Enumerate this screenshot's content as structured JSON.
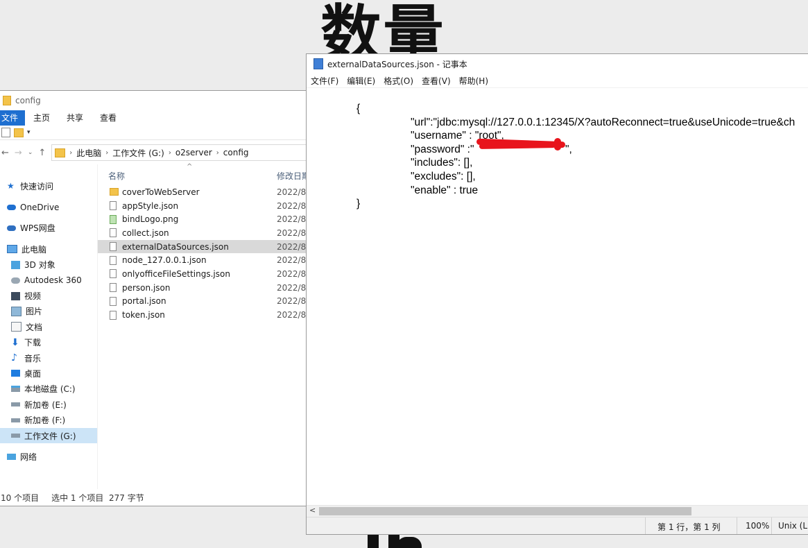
{
  "background": {
    "top_text": "数量"
  },
  "explorer": {
    "title": "config",
    "ribbon_tabs": [
      "文件",
      "主页",
      "共享",
      "查看"
    ],
    "address": [
      "此电脑",
      "工作文件 (G:)",
      "o2server",
      "config"
    ],
    "columns": {
      "name": "名称",
      "date": "修改日期"
    },
    "nav": [
      {
        "label": "快速访问",
        "icon": "star-icon"
      },
      {
        "label": "OneDrive",
        "icon": "cloud-icon"
      },
      {
        "label": "WPS网盘",
        "icon": "wps-cloud-icon"
      },
      {
        "label": "此电脑",
        "icon": "computer-icon"
      },
      {
        "label": "3D 对象",
        "icon": "cube-icon"
      },
      {
        "label": "Autodesk 360",
        "icon": "autodesk-icon"
      },
      {
        "label": "视频",
        "icon": "video-icon"
      },
      {
        "label": "图片",
        "icon": "pictures-icon"
      },
      {
        "label": "文档",
        "icon": "documents-icon"
      },
      {
        "label": "下载",
        "icon": "download-icon"
      },
      {
        "label": "音乐",
        "icon": "music-icon"
      },
      {
        "label": "桌面",
        "icon": "desktop-icon"
      },
      {
        "label": "本地磁盘 (C:)",
        "icon": "drive-icon"
      },
      {
        "label": "新加卷 (E:)",
        "icon": "drive-icon"
      },
      {
        "label": "新加卷 (F:)",
        "icon": "drive-icon"
      },
      {
        "label": "工作文件 (G:)",
        "icon": "drive-icon"
      },
      {
        "label": "网络",
        "icon": "network-icon"
      }
    ],
    "files": [
      {
        "name": "coverToWebServer",
        "date": "2022/8/",
        "type": "folder"
      },
      {
        "name": "appStyle.json",
        "date": "2022/8/",
        "type": "file"
      },
      {
        "name": "bindLogo.png",
        "date": "2022/8/",
        "type": "image"
      },
      {
        "name": "collect.json",
        "date": "2022/8/",
        "type": "file"
      },
      {
        "name": "externalDataSources.json",
        "date": "2022/8/",
        "type": "file"
      },
      {
        "name": "node_127.0.0.1.json",
        "date": "2022/8/",
        "type": "file"
      },
      {
        "name": "onlyofficeFileSettings.json",
        "date": "2022/8/",
        "type": "file"
      },
      {
        "name": "person.json",
        "date": "2022/8/",
        "type": "file"
      },
      {
        "name": "portal.json",
        "date": "2022/8/",
        "type": "file"
      },
      {
        "name": "token.json",
        "date": "2022/8/",
        "type": "file"
      }
    ],
    "status": {
      "count": "10 个项目",
      "selection": "选中 1 个项目  277 字节"
    }
  },
  "notepad": {
    "title": "externalDataSources.json - 记事本",
    "menu": [
      "文件(F)",
      "编辑(E)",
      "格式(O)",
      "查看(V)",
      "帮助(H)"
    ],
    "lines": [
      "{",
      "\"url\":\"jdbc:mysql://127.0.0.1:12345/X?autoReconnect=true&useUnicode=true&ch",
      "\"username\" : \"root\",",
      "\"password\" :\"",
      "\"includes\": [],",
      "\"excludes\": [],",
      "\"enable\" : true",
      "}"
    ],
    "password_tail": "\",",
    "status": {
      "position": "第 1 行，第 1 列",
      "zoom": "100%",
      "eol": "Unix (LF)"
    }
  }
}
